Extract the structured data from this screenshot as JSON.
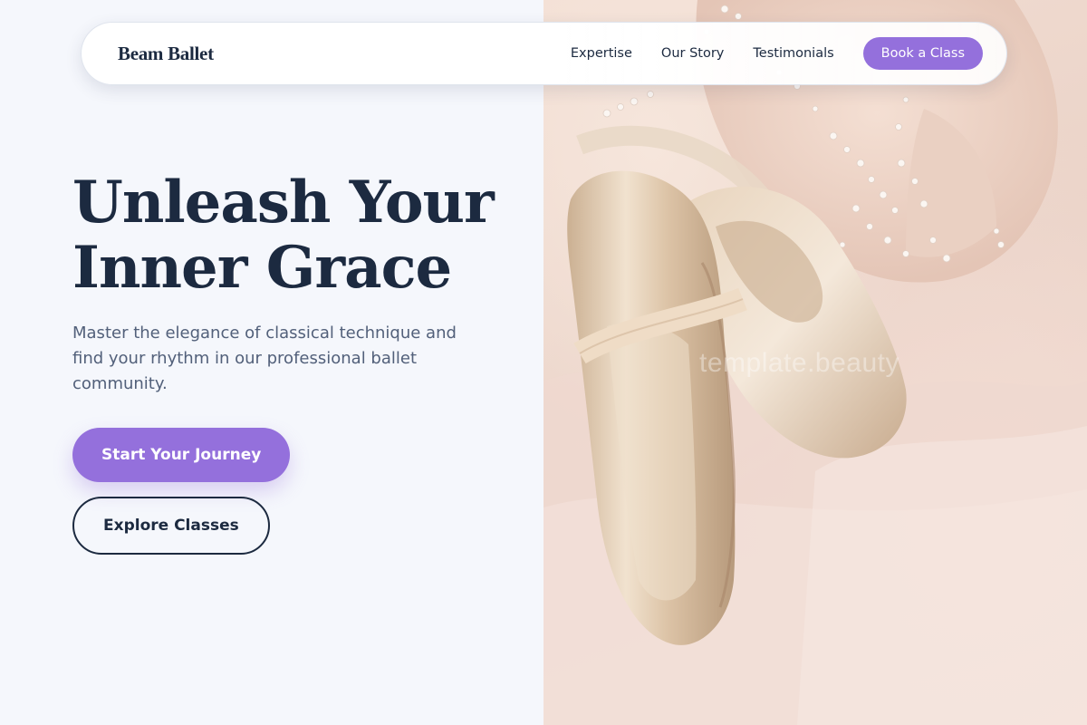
{
  "brand": {
    "name": "Beam Ballet"
  },
  "nav": {
    "links": [
      "Expertise",
      "Our Story",
      "Testimonials"
    ],
    "cta": "Book a Class"
  },
  "hero": {
    "title_line1": "Unleash Your",
    "title_line2": "Inner Grace",
    "subtitle": "Master the elegance of classical technique and find your rhythm in our professional ballet community.",
    "primary_button": "Start Your Journey",
    "secondary_button": "Explore Classes"
  },
  "image": {
    "subject": "satin-pointe-shoes-on-pink-tulle",
    "watermark": "template.beauty"
  },
  "colors": {
    "accent": "#9470dc",
    "navy": "#1c2a40",
    "muted_text": "#52607a",
    "background": "#f5f7fc",
    "blush": "#ecd4c9"
  }
}
